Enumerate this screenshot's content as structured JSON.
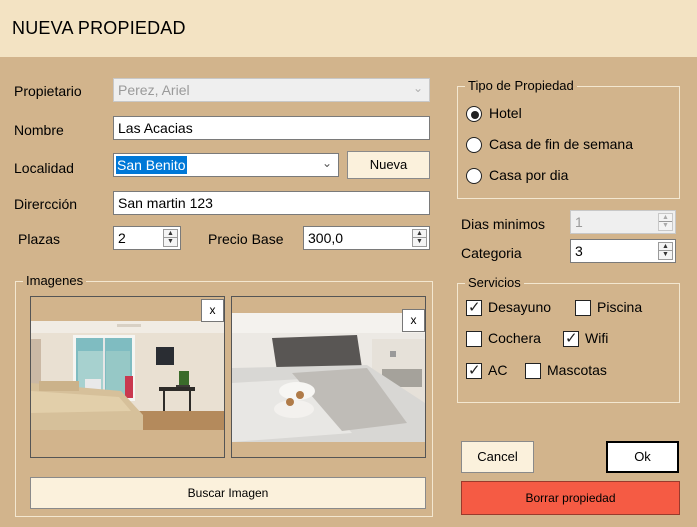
{
  "window": {
    "title": "NUEVA PROPIEDAD"
  },
  "form": {
    "propietario": {
      "label": "Propietario",
      "value": "Perez, Ariel"
    },
    "nombre": {
      "label": "Nombre",
      "value": "Las Acacias"
    },
    "localidad": {
      "label": "Localidad",
      "value": "San Benito",
      "new_button": "Nueva"
    },
    "direccion": {
      "label": "Dirercción",
      "value": "San martin 123"
    },
    "plazas": {
      "label": "Plazas",
      "value": "2"
    },
    "precio_base": {
      "label": "Precio Base",
      "value": "300,0"
    }
  },
  "tipo_propiedad": {
    "legend": "Tipo de Propiedad",
    "options": [
      "Hotel",
      "Casa de fin de semana",
      "Casa por dia"
    ],
    "selected": "Hotel"
  },
  "dias_minimos": {
    "label": "Dias minimos",
    "value": "1"
  },
  "categoria": {
    "label": "Categoria",
    "value": "3"
  },
  "servicios": {
    "legend": "Servicios",
    "items": [
      {
        "label": "Desayuno",
        "checked": true
      },
      {
        "label": "Piscina",
        "checked": false
      },
      {
        "label": "Cochera",
        "checked": false
      },
      {
        "label": "Wifi",
        "checked": true
      },
      {
        "label": "AC",
        "checked": true
      },
      {
        "label": "Mascotas",
        "checked": false
      }
    ]
  },
  "imagenes": {
    "legend": "Imagenes",
    "remove_label": "x",
    "browse_button": "Buscar Imagen"
  },
  "actions": {
    "cancel": "Cancel",
    "ok": "Ok",
    "delete": "Borrar propiedad"
  },
  "colors": {
    "background": "#d2b48c",
    "titlebar": "#f3e3c3",
    "button": "#fbf1dc",
    "delete_button": "#f55b44",
    "selection": "#0078d7"
  }
}
